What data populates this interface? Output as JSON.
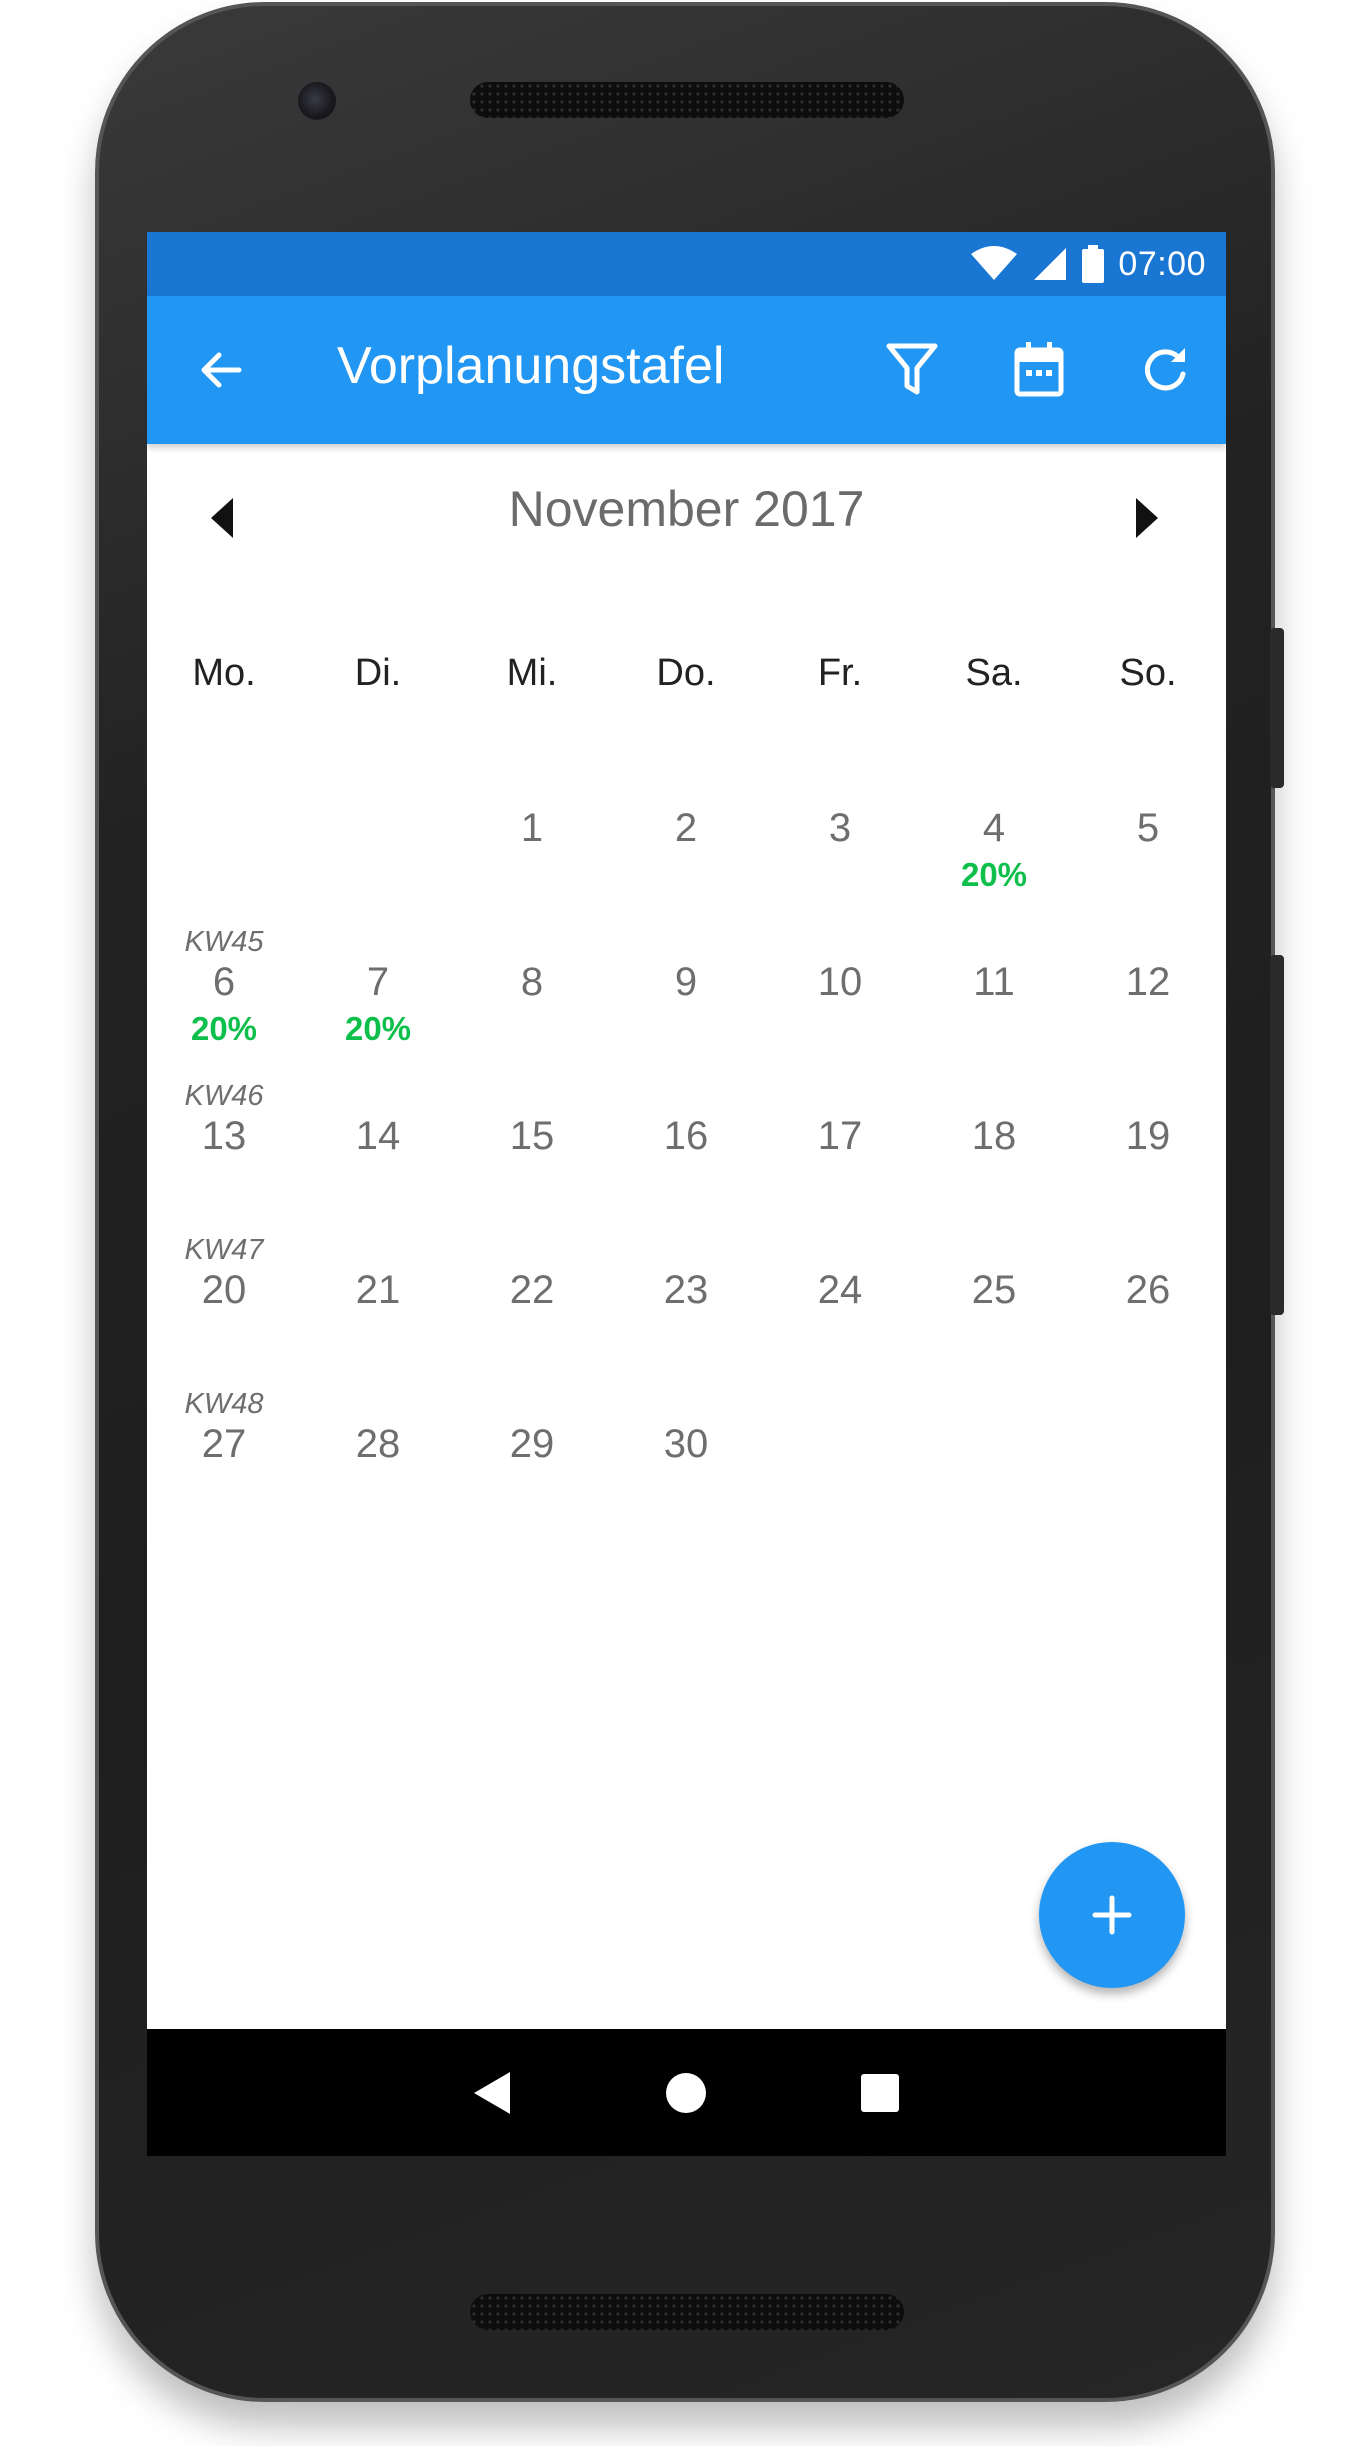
{
  "status_bar": {
    "time": "07:00"
  },
  "app_bar": {
    "title": "Vorplanungstafel"
  },
  "calendar": {
    "month_title": "November 2017",
    "weekdays": [
      "Mo.",
      "Di.",
      "Mi.",
      "Do.",
      "Fr.",
      "Sa.",
      "So."
    ],
    "weeks": [
      {
        "kw": "",
        "days": [
          {
            "d": "",
            "p": ""
          },
          {
            "d": "",
            "p": ""
          },
          {
            "d": "1",
            "p": ""
          },
          {
            "d": "2",
            "p": ""
          },
          {
            "d": "3",
            "p": ""
          },
          {
            "d": "4",
            "p": "20%"
          },
          {
            "d": "5",
            "p": ""
          }
        ]
      },
      {
        "kw": "KW45",
        "days": [
          {
            "d": "6",
            "p": "20%"
          },
          {
            "d": "7",
            "p": "20%"
          },
          {
            "d": "8",
            "p": ""
          },
          {
            "d": "9",
            "p": ""
          },
          {
            "d": "10",
            "p": ""
          },
          {
            "d": "11",
            "p": ""
          },
          {
            "d": "12",
            "p": ""
          }
        ]
      },
      {
        "kw": "KW46",
        "days": [
          {
            "d": "13",
            "p": ""
          },
          {
            "d": "14",
            "p": ""
          },
          {
            "d": "15",
            "p": ""
          },
          {
            "d": "16",
            "p": ""
          },
          {
            "d": "17",
            "p": ""
          },
          {
            "d": "18",
            "p": ""
          },
          {
            "d": "19",
            "p": ""
          }
        ]
      },
      {
        "kw": "KW47",
        "days": [
          {
            "d": "20",
            "p": ""
          },
          {
            "d": "21",
            "p": ""
          },
          {
            "d": "22",
            "p": ""
          },
          {
            "d": "23",
            "p": ""
          },
          {
            "d": "24",
            "p": ""
          },
          {
            "d": "25",
            "p": ""
          },
          {
            "d": "26",
            "p": ""
          }
        ]
      },
      {
        "kw": "KW48",
        "days": [
          {
            "d": "27",
            "p": ""
          },
          {
            "d": "28",
            "p": ""
          },
          {
            "d": "29",
            "p": ""
          },
          {
            "d": "30",
            "p": ""
          },
          {
            "d": "",
            "p": ""
          },
          {
            "d": "",
            "p": ""
          },
          {
            "d": "",
            "p": ""
          }
        ]
      }
    ]
  },
  "icons": {
    "back": "arrow-left-icon",
    "filter": "filter-icon",
    "calendar": "calendar-icon",
    "refresh": "refresh-icon",
    "prev": "triangle-left-icon",
    "next": "triangle-right-icon",
    "fab": "plus-icon"
  },
  "colors": {
    "status_bar": "#1976d2",
    "app_bar": "#2196f3",
    "percent": "#0fbf4c",
    "fab": "#2196f3"
  }
}
